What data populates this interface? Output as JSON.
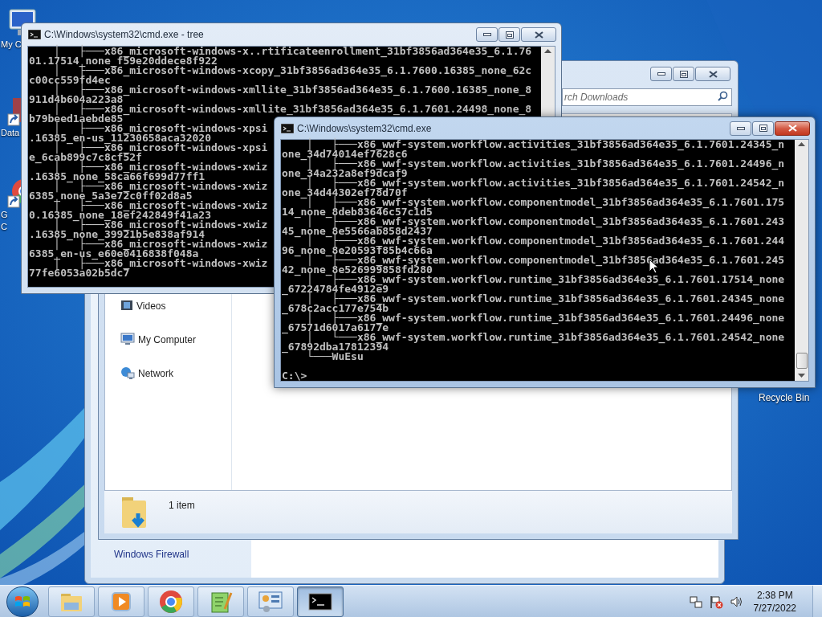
{
  "desktop": {
    "icons": [
      {
        "kind": "computer",
        "lines": [
          "My C"
        ]
      },
      {
        "kind": "shortcut",
        "lines": [
          "Data"
        ]
      },
      {
        "kind": "chrome",
        "lines": [
          "G",
          "C"
        ]
      }
    ],
    "recycle_bin": {
      "label": "Recycle Bin"
    }
  },
  "control_panel_window": {
    "nav_items": [
      "Windows Firewall"
    ]
  },
  "explorer_window": {
    "search": {
      "placeholder": "rch Downloads"
    },
    "nav_items": [
      {
        "label": "Videos",
        "kind": "film"
      },
      {
        "label": "My Computer",
        "kind": "computer"
      },
      {
        "label": "Network",
        "kind": "network"
      }
    ],
    "status": "1 item"
  },
  "cmd_tree_window": {
    "title": "C:\\Windows\\system32\\cmd.exe - tree",
    "active": false,
    "lines": [
      "    │   ├───x86_microsoft-windows-x..rtificateenrollment_31bf3856ad364e35_6.1.76",
      "01.17514_none_f59e20ddece8f922",
      "    │   ├───x86_microsoft-windows-xcopy_31bf3856ad364e35_6.1.7600.16385_none_62c",
      "c00cc559fd4ec",
      "    │   ├───x86_microsoft-windows-xmllite_31bf3856ad364e35_6.1.7600.16385_none_8",
      "911d4b604a223a8",
      "    │   ├───x86_microsoft-windows-xmllite_31bf3856ad364e35_6.1.7601.24498_none_8",
      "b79beed1aebde85",
      "    │   ├───x86_microsoft-windows-xpsi",
      ".16385_en-us_11230658aca32020",
      "    │   ├───x86_microsoft-windows-xpsi",
      "e_6cab899c7c8cf52f",
      "    │   ├───x86_microsoft-windows-xwiz",
      ".16385_none_58ca66f699d77ff1",
      "    │   ├───x86_microsoft-windows-xwiz",
      "6385_none_5a3e72c0ff02d8a5",
      "    │   ├───x86_microsoft-windows-xwiz",
      "0.16385_none_18ef242849f41a23",
      "    │   ├───x86_microsoft-windows-xwiz",
      ".16385_none_39921b5e838af914",
      "    │   ├───x86_microsoft-windows-xwiz",
      "6385_en-us_e60e0416838f048a",
      "    │   ├───x86_microsoft-windows-xwiz",
      "77fe6053a02b5dc7"
    ]
  },
  "cmd_window": {
    "title": "C:\\Windows\\system32\\cmd.exe",
    "active": true,
    "lines": [
      "    │   ├───x86_wwf-system.workflow.activities_31bf3856ad364e35_6.1.7601.24345_n",
      "one_34d74014ef7628c6",
      "    │   ├───x86_wwf-system.workflow.activities_31bf3856ad364e35_6.1.7601.24496_n",
      "one_34a232a8ef9dcaf9",
      "    │   ├───x86_wwf-system.workflow.activities_31bf3856ad364e35_6.1.7601.24542_n",
      "one_34d44302ef78d70f",
      "    │   ├───x86_wwf-system.workflow.componentmodel_31bf3856ad364e35_6.1.7601.175",
      "14_none_8deb83646c57c1d5",
      "    │   ├───x86_wwf-system.workflow.componentmodel_31bf3856ad364e35_6.1.7601.243",
      "45_none_8e5566ab858d2437",
      "    │   ├───x86_wwf-system.workflow.componentmodel_31bf3856ad364e35_6.1.7601.244",
      "96_none_8e20593f85b4c66a",
      "    │   ├───x86_wwf-system.workflow.componentmodel_31bf3856ad364e35_6.1.7601.245",
      "42_none_8e526999858fd280",
      "    │   ├───x86_wwf-system.workflow.runtime_31bf3856ad364e35_6.1.7601.17514_none",
      "_67224784fe4912e9",
      "    │   ├───x86_wwf-system.workflow.runtime_31bf3856ad364e35_6.1.7601.24345_none",
      "_678c2acc177e754b",
      "    │   ├───x86_wwf-system.workflow.runtime_31bf3856ad364e35_6.1.7601.24496_none",
      "_67571d6017a6177e",
      "    │   └───x86_wwf-system.workflow.runtime_31bf3856ad364e35_6.1.7601.24542_none",
      "_67892dba17812394",
      "    └───WuEsu"
    ],
    "prompt": "C:\\>"
  },
  "taskbar": {
    "buttons": [
      {
        "kind": "folder",
        "selected": false
      },
      {
        "kind": "media",
        "selected": false
      },
      {
        "kind": "chrome",
        "selected": false
      },
      {
        "kind": "notepad",
        "selected": false
      },
      {
        "kind": "panel",
        "selected": false
      },
      {
        "kind": "console",
        "selected": true
      }
    ],
    "clock": {
      "time": "2:38 PM",
      "date": "7/27/2022"
    }
  }
}
